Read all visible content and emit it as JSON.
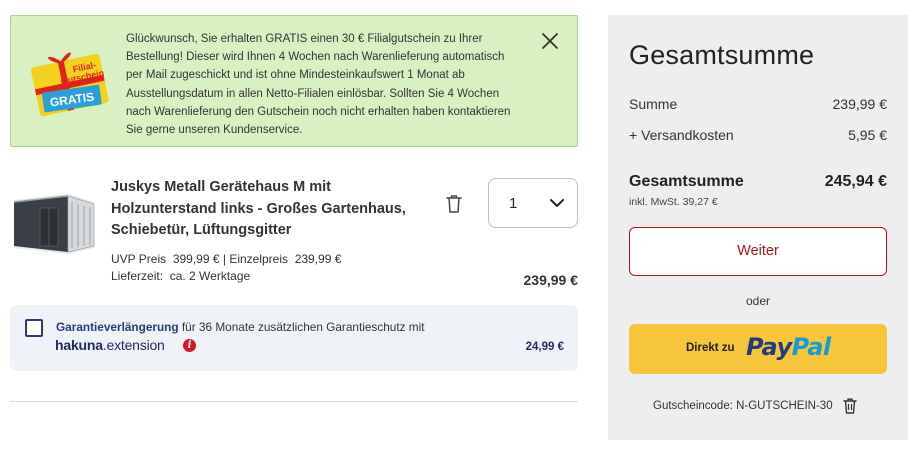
{
  "banner": {
    "message": "Glückwunsch, Sie erhalten GRATIS einen 30 € Filialgutschein zu Ihrer Bestellung! Dieser wird Ihnen 4 Wochen nach Warenlieferung automatisch per Mail zugeschickt und ist ohne Mindesteinkaufswert 1 Monat ab Ausstellungsdatum in allen Netto-Filialen einlösbar. Sollten Sie 4 Wochen nach Warenlieferung den Gutschein noch nicht erhalten haben kontaktieren Sie gerne unseren Kundenservice.",
    "badge_line1": "Filial-",
    "badge_line2": "Gutschein",
    "badge_gratis": "GRATIS",
    "close_icon": "close-icon"
  },
  "product": {
    "title": "Juskys Metall Gerätehaus M mit Holzunterstand links - Großes Gartenhaus, Schiebetür, Lüftungsgitter",
    "uvp_label": "UVP Preis",
    "uvp_value": "399,99 €",
    "unit_label": "| Einzelpreis",
    "unit_value": "239,99 €",
    "delivery_label": "Lieferzeit:",
    "delivery_value": "ca. 2 Werktage",
    "quantity": "1",
    "total": "239,99 €",
    "trash_icon": "trash-icon"
  },
  "warranty": {
    "label_strong": "Garantieverlängerung",
    "label_rest": " für 36 Monate zusätzlichen Garantieschutz mit",
    "logo_bold": "hakuna",
    "logo_rest": ".extension",
    "info_glyph": "i",
    "price": "24,99 €"
  },
  "summary": {
    "title": "Gesamtsumme",
    "sum_label": "Summe",
    "sum_value": "239,99 €",
    "shipping_label": "+ Versandkosten",
    "shipping_value": "5,95 €",
    "total_label": "Gesamtsumme",
    "total_value": "245,94 €",
    "tax_note": "inkl. MwSt. 39,27 €",
    "continue_button": "Weiter",
    "or_text": "oder",
    "paypal_prefix": "Direkt zu",
    "paypal_part1": "Pay",
    "paypal_part2": "Pal",
    "voucher_code": "Gutscheincode: N-GUTSCHEIN-30"
  },
  "colors": {
    "banner_bg": "#d9f0c3",
    "brand_red": "#b5121b",
    "paypal_yellow": "#f7c53c",
    "summary_bg": "#edeef0",
    "warranty_bg": "#eff3f8"
  }
}
